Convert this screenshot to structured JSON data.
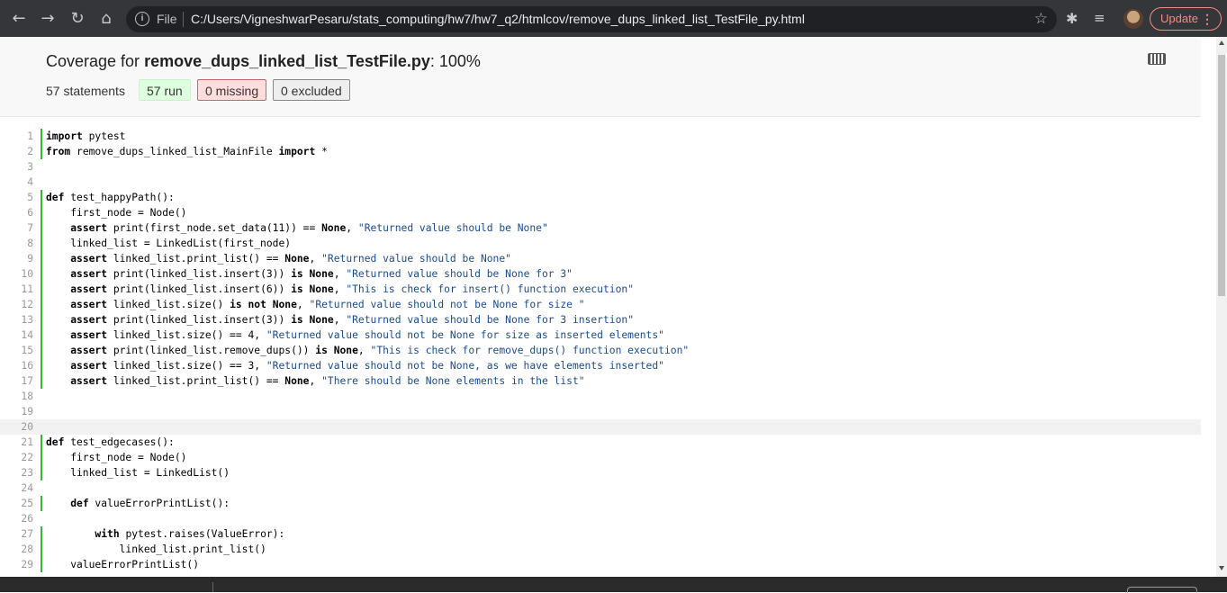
{
  "browser": {
    "file_label": "File",
    "url": "C:/Users/VigneshwarPesaru/stats_computing/hw7/hw7_q2/htmlcov/remove_dups_linked_list_TestFile_py.html",
    "update_label": "Update",
    "update_dots": "⋮"
  },
  "header": {
    "title_prefix": "Coverage for ",
    "title_file": "remove_dups_linked_list_TestFile.py",
    "title_suffix": ": 100%",
    "statements": "57 statements",
    "run": "57 run",
    "missing": "0 missing",
    "excluded": "0 excluded"
  },
  "source_lines": [
    {
      "n": "1",
      "run": true,
      "code": [
        [
          "k",
          "import"
        ],
        [
          "t",
          " pytest"
        ]
      ]
    },
    {
      "n": "2",
      "run": true,
      "code": [
        [
          "k",
          "from"
        ],
        [
          "t",
          " remove_dups_linked_list_MainFile "
        ],
        [
          "k",
          "import"
        ],
        [
          "t",
          " *"
        ]
      ]
    },
    {
      "n": "3",
      "run": false,
      "code": []
    },
    {
      "n": "4",
      "run": false,
      "code": []
    },
    {
      "n": "5",
      "run": true,
      "code": [
        [
          "k",
          "def"
        ],
        [
          "t",
          " test_happyPath():"
        ]
      ]
    },
    {
      "n": "6",
      "run": true,
      "code": [
        [
          "t",
          "    first_node = Node()"
        ]
      ]
    },
    {
      "n": "7",
      "run": true,
      "code": [
        [
          "t",
          "    "
        ],
        [
          "k",
          "assert"
        ],
        [
          "t",
          " print(first_node.set_data(11)) == "
        ],
        [
          "k",
          "None"
        ],
        [
          "t",
          ", "
        ],
        [
          "s",
          "\"Returned value should be None\""
        ]
      ]
    },
    {
      "n": "8",
      "run": true,
      "code": [
        [
          "t",
          "    linked_list = LinkedList(first_node)"
        ]
      ]
    },
    {
      "n": "9",
      "run": true,
      "code": [
        [
          "t",
          "    "
        ],
        [
          "k",
          "assert"
        ],
        [
          "t",
          " linked_list.print_list() == "
        ],
        [
          "k",
          "None"
        ],
        [
          "t",
          ", "
        ],
        [
          "s",
          "\"Returned value should be None\""
        ]
      ]
    },
    {
      "n": "10",
      "run": true,
      "code": [
        [
          "t",
          "    "
        ],
        [
          "k",
          "assert"
        ],
        [
          "t",
          " print(linked_list.insert(3)) "
        ],
        [
          "k",
          "is"
        ],
        [
          "t",
          " "
        ],
        [
          "k",
          "None"
        ],
        [
          "t",
          ", "
        ],
        [
          "s",
          "\"Returned value should be None for 3\""
        ]
      ]
    },
    {
      "n": "11",
      "run": true,
      "code": [
        [
          "t",
          "    "
        ],
        [
          "k",
          "assert"
        ],
        [
          "t",
          " print(linked_list.insert(6)) "
        ],
        [
          "k",
          "is"
        ],
        [
          "t",
          " "
        ],
        [
          "k",
          "None"
        ],
        [
          "t",
          ", "
        ],
        [
          "s",
          "\"This is check for insert() function execution\""
        ]
      ]
    },
    {
      "n": "12",
      "run": true,
      "code": [
        [
          "t",
          "    "
        ],
        [
          "k",
          "assert"
        ],
        [
          "t",
          " linked_list.size() "
        ],
        [
          "k",
          "is not"
        ],
        [
          "t",
          " "
        ],
        [
          "k",
          "None"
        ],
        [
          "t",
          ", "
        ],
        [
          "s",
          "\"Returned value should not be None for size \""
        ]
      ]
    },
    {
      "n": "13",
      "run": true,
      "code": [
        [
          "t",
          "    "
        ],
        [
          "k",
          "assert"
        ],
        [
          "t",
          " print(linked_list.insert(3)) "
        ],
        [
          "k",
          "is"
        ],
        [
          "t",
          " "
        ],
        [
          "k",
          "None"
        ],
        [
          "t",
          ", "
        ],
        [
          "s",
          "\"Returned value should be None for 3 insertion\""
        ]
      ]
    },
    {
      "n": "14",
      "run": true,
      "code": [
        [
          "t",
          "    "
        ],
        [
          "k",
          "assert"
        ],
        [
          "t",
          " linked_list.size() == 4, "
        ],
        [
          "s",
          "\"Returned value should not be None for size as inserted elements\""
        ]
      ]
    },
    {
      "n": "15",
      "run": true,
      "code": [
        [
          "t",
          "    "
        ],
        [
          "k",
          "assert"
        ],
        [
          "t",
          " print(linked_list.remove_dups()) "
        ],
        [
          "k",
          "is"
        ],
        [
          "t",
          " "
        ],
        [
          "k",
          "None"
        ],
        [
          "t",
          ", "
        ],
        [
          "s",
          "\"This is check for remove_dups() function execution\""
        ]
      ]
    },
    {
      "n": "16",
      "run": true,
      "code": [
        [
          "t",
          "    "
        ],
        [
          "k",
          "assert"
        ],
        [
          "t",
          " linked_list.size() == 3, "
        ],
        [
          "s",
          "\"Returned value should not be None, as we have elements inserted\""
        ]
      ]
    },
    {
      "n": "17",
      "run": true,
      "code": [
        [
          "t",
          "    "
        ],
        [
          "k",
          "assert"
        ],
        [
          "t",
          " linked_list.print_list() == "
        ],
        [
          "k",
          "None"
        ],
        [
          "t",
          ", "
        ],
        [
          "s",
          "\"There should be None elements in the list\""
        ]
      ]
    },
    {
      "n": "18",
      "run": false,
      "code": []
    },
    {
      "n": "19",
      "run": false,
      "code": []
    },
    {
      "n": "20",
      "run": false,
      "hl": true,
      "code": []
    },
    {
      "n": "21",
      "run": true,
      "code": [
        [
          "k",
          "def"
        ],
        [
          "t",
          " test_edgecases():"
        ]
      ]
    },
    {
      "n": "22",
      "run": true,
      "code": [
        [
          "t",
          "    first_node = Node()"
        ]
      ]
    },
    {
      "n": "23",
      "run": true,
      "code": [
        [
          "t",
          "    linked_list = LinkedList()"
        ]
      ]
    },
    {
      "n": "24",
      "run": false,
      "code": []
    },
    {
      "n": "25",
      "run": true,
      "code": [
        [
          "t",
          "    "
        ],
        [
          "k",
          "def"
        ],
        [
          "t",
          " valueErrorPrintList():"
        ]
      ]
    },
    {
      "n": "26",
      "run": false,
      "code": []
    },
    {
      "n": "27",
      "run": true,
      "code": [
        [
          "t",
          "        "
        ],
        [
          "k",
          "with"
        ],
        [
          "t",
          " pytest.raises(ValueError):"
        ]
      ]
    },
    {
      "n": "28",
      "run": true,
      "code": [
        [
          "t",
          "            linked_list.print_list()"
        ]
      ]
    },
    {
      "n": "29",
      "run": true,
      "code": [
        [
          "t",
          "    valueErrorPrintList()"
        ]
      ]
    }
  ]
}
